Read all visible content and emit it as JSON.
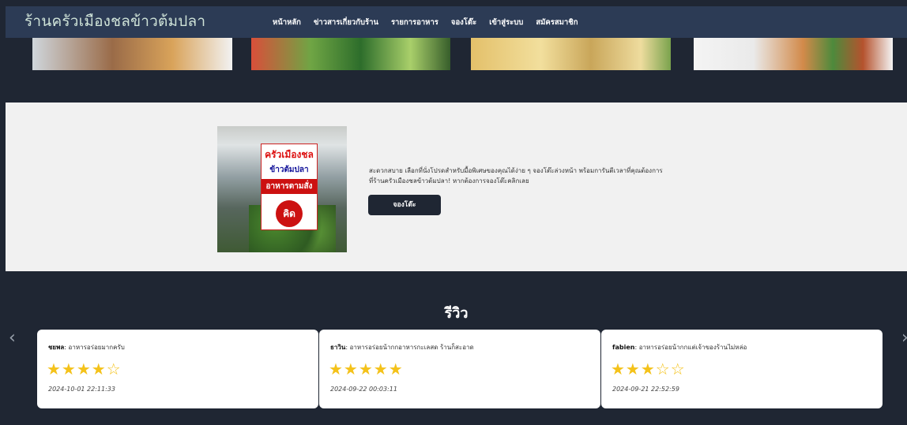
{
  "header": {
    "brand": "ร้านครัวเมืองชลข้าวต้มปลา",
    "nav": [
      {
        "label": "หน้าหลัก"
      },
      {
        "label": "ข่าวสารเกี่ยวกับร้าน"
      },
      {
        "label": "รายการอาหาร"
      },
      {
        "label": "จองโต๊ะ"
      },
      {
        "label": "เข้าสู่ระบบ"
      },
      {
        "label": "สมัครสมาชิก"
      }
    ]
  },
  "promo": {
    "sign": {
      "line1": "ครัวเมืองชล",
      "line2": "ข้าวต้มปลา",
      "line3": "อาหารตามสั่ง",
      "logo": "คิด"
    },
    "text_line1": "สะดวกสบาย เลือกที่นั่งโปรดสำหรับมื้อพิเศษของคุณได้ง่าย ๆ จองโต๊ะล่วงหน้า พร้อมการันตีเวลาที่คุณต้องการ",
    "text_line2": "ที่ร้านครัวเมืองชลข้าวต้มปลา! หากต้องการจองโต๊ะคลิกเลย",
    "button": "จองโต๊ะ"
  },
  "reviews": {
    "title": "รีวิว",
    "items": [
      {
        "name": "ชยพล",
        "text": ": อาหารอร่อยมากครับ",
        "stars": "★★★★☆",
        "time": "2024-10-01 22:11:33"
      },
      {
        "name": "ธาวิน",
        "text": ": อาหารอร่อยน้ากกอาหารกะเลสด ร้านก็สะอาด",
        "stars": "★★★★★",
        "time": "2024-09-22 00:03:11"
      },
      {
        "name": "fabien",
        "text": ": อาหารอร่อยน้ากกแต่เจ้าของร้านไม่หล่อ",
        "stars": "★★★☆☆",
        "time": "2024-09-21 22:52:59"
      }
    ],
    "prev_arrow": "‹",
    "next_arrow": "›"
  }
}
